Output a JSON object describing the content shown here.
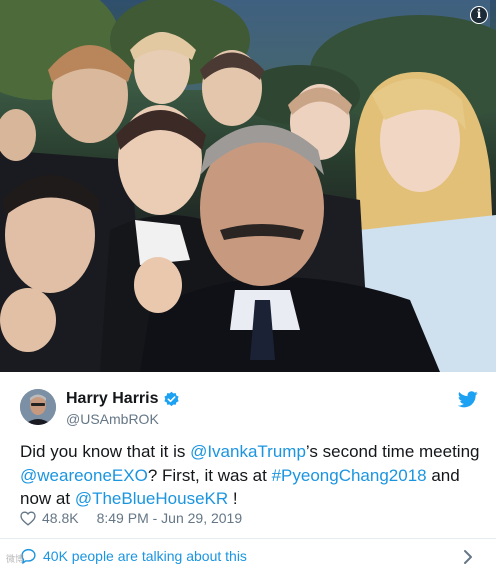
{
  "tweet": {
    "author_name": "Harry Harris",
    "author_handle": "@USAmbROK",
    "text": {
      "p1": "Did you know that it is ",
      "m1": "@IvankaTrump",
      "p2": "’s second time meeting ",
      "m2": "@weareoneEXO",
      "p3": "? First, it was at ",
      "m3": "#PyeongChang2018",
      "p4": " and now at ",
      "m4": "@TheBlueHouseKR",
      "p5": " !"
    },
    "likes": "48.8K",
    "timestamp": "8:49 PM - Jun 29, 2019",
    "talking": "40K people are talking about this",
    "watermark": "微博"
  },
  "icons": {
    "verified": "verified-badge-icon",
    "bird": "twitter-bird-icon",
    "heart": "heart-icon",
    "bubble": "reply-bubble-icon",
    "chevron": "chevron-right-icon",
    "info": "info-icon"
  },
  "colors": {
    "link": "#1b95e0",
    "text": "#14171a",
    "muted": "#657786",
    "divider": "#e6ecf0"
  }
}
